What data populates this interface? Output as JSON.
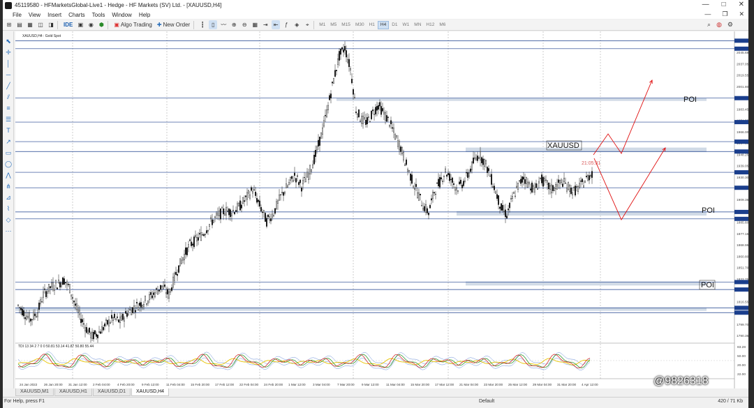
{
  "window": {
    "title": "45119580 - HFMarketsGlobal-Live1 - Hedge - HF Markets (SV) Ltd. - [XAUUSD,H4]",
    "controls": [
      "—",
      "□",
      "✕"
    ]
  },
  "menu": {
    "items": [
      "File",
      "View",
      "Insert",
      "Charts",
      "Tools",
      "Window",
      "Help"
    ],
    "mdi_controls": [
      "—",
      "❐",
      "✕"
    ]
  },
  "toolbar": {
    "algo_trading": "Algo Trading",
    "new_order": "New Order",
    "ide_label": "IDE",
    "timeframes": [
      "M1",
      "M5",
      "M15",
      "M30",
      "H1",
      "H4",
      "D1",
      "W1",
      "MN",
      "H12",
      "M6"
    ],
    "active_timeframe": "H4"
  },
  "chart": {
    "header": "XAUUSD,H4 : Gold Spot",
    "countdown": "21:05:31",
    "price_ticks": [
      "2063.40",
      "2045.68",
      "2037.05",
      "2019.55",
      "2001.80",
      "1992.90",
      "1983.45",
      "1974.55",
      "1966.00",
      "1957.50",
      "1948.25",
      "1939.05",
      "1930.30",
      "1921.65",
      "1909.35",
      "1903.50",
      "1885.60",
      "1877.15",
      "1868.95",
      "1860.80",
      "1851.70",
      "1833.75",
      "1824.75",
      "1816.55",
      "1807.95",
      "1799.70",
      "1790.35"
    ],
    "ind_ticks": [
      "83.28",
      "50.00",
      "20.00",
      "22.00"
    ],
    "time_ticks": [
      "24 Jan 2022",
      "26 Jan 20:00",
      "31 Jan 12:00",
      "2 Feb 04:00",
      "4 Feb 20:00",
      "9 Feb 12:00",
      "11 Feb 04:00",
      "15 Feb 20:00",
      "17 Feb 12:00",
      "22 Feb 04:00",
      "24 Feb 20:00",
      "1 Mar 12:00",
      "3 Mar 04:00",
      "7 Mar 20:00",
      "9 Mar 12:00",
      "11 Mar 04:00",
      "15 Mar 20:00",
      "17 Mar 12:00",
      "21 Mar 04:00",
      "23 Mar 20:00",
      "25 Mar 12:00",
      "29 Mar 04:00",
      "31 Mar 20:00",
      "4 Apr 12:00"
    ],
    "indicator_label": "TDI 13 34 2 7 0 0 50.81 53.14 41.87 50.80 55.44",
    "annotations": {
      "poi_top": "POI",
      "poi_mid": "POI",
      "poi_bottom": "POI",
      "symbol_box": "XAUUSD"
    }
  },
  "chart_data": {
    "type": "candlestick",
    "symbol": "XAUUSD",
    "timeframe": "H4",
    "title": "XAUUSD,H4 : Gold Spot",
    "x_range": [
      "24 Jan 2022",
      "4 Apr 2022"
    ],
    "y_range": [
      1784,
      2070
    ],
    "horizontal_levels": [
      2066.5,
      2059.0,
      2012.6,
      1990.1,
      1971.8,
      1962.5,
      1943.0,
      1928.5,
      1905.8,
      1899.3,
      1840.0,
      1833.0,
      1815.8,
      1811.3
    ],
    "path_points": [
      [
        0,
        1818
      ],
      [
        5,
        1810
      ],
      [
        9,
        1805
      ],
      [
        14,
        1812
      ],
      [
        18,
        1828
      ],
      [
        23,
        1835
      ],
      [
        28,
        1838
      ],
      [
        33,
        1842
      ],
      [
        37,
        1834
      ],
      [
        41,
        1818
      ],
      [
        45,
        1806
      ],
      [
        49,
        1796
      ],
      [
        53,
        1789
      ],
      [
        58,
        1793
      ],
      [
        63,
        1800
      ],
      [
        68,
        1806
      ],
      [
        73,
        1803
      ],
      [
        78,
        1811
      ],
      [
        83,
        1816
      ],
      [
        88,
        1820
      ],
      [
        93,
        1824
      ],
      [
        98,
        1830
      ],
      [
        103,
        1836
      ],
      [
        108,
        1828
      ],
      [
        113,
        1848
      ],
      [
        118,
        1863
      ],
      [
        123,
        1875
      ],
      [
        128,
        1880
      ],
      [
        133,
        1886
      ],
      [
        138,
        1896
      ],
      [
        143,
        1902
      ],
      [
        148,
        1907
      ],
      [
        153,
        1906
      ],
      [
        158,
        1910
      ],
      [
        163,
        1918
      ],
      [
        168,
        1927
      ],
      [
        173,
        1912
      ],
      [
        178,
        1897
      ],
      [
        183,
        1905
      ],
      [
        188,
        1920
      ],
      [
        193,
        1930
      ],
      [
        198,
        1940
      ],
      [
        203,
        1930
      ],
      [
        208,
        1941
      ],
      [
        213,
        1959
      ],
      [
        218,
        1982
      ],
      [
        222,
        2005
      ],
      [
        226,
        2030
      ],
      [
        230,
        2052
      ],
      [
        234,
        2060
      ],
      [
        238,
        2040
      ],
      [
        242,
        2002
      ],
      [
        246,
        1992
      ],
      [
        250,
        1990
      ],
      [
        254,
        1999
      ],
      [
        258,
        2006
      ],
      [
        262,
        1998
      ],
      [
        266,
        1990
      ],
      [
        270,
        1977
      ],
      [
        274,
        1966
      ],
      [
        278,
        1950
      ],
      [
        282,
        1936
      ],
      [
        286,
        1924
      ],
      [
        290,
        1912
      ],
      [
        294,
        1905
      ],
      [
        298,
        1925
      ],
      [
        302,
        1934
      ],
      [
        306,
        1944
      ],
      [
        310,
        1937
      ],
      [
        314,
        1928
      ],
      [
        318,
        1932
      ],
      [
        322,
        1940
      ],
      [
        326,
        1952
      ],
      [
        330,
        1960
      ],
      [
        334,
        1953
      ],
      [
        338,
        1940
      ],
      [
        342,
        1925
      ],
      [
        346,
        1909
      ],
      [
        350,
        1903
      ],
      [
        354,
        1918
      ],
      [
        358,
        1930
      ],
      [
        362,
        1938
      ],
      [
        366,
        1932
      ],
      [
        370,
        1926
      ],
      [
        374,
        1937
      ],
      [
        378,
        1932
      ],
      [
        382,
        1927
      ],
      [
        386,
        1931
      ],
      [
        390,
        1934
      ],
      [
        394,
        1929
      ],
      [
        398,
        1925
      ],
      [
        402,
        1929
      ],
      [
        406,
        1935
      ],
      [
        410,
        1941
      ],
      [
        414,
        1946
      ]
    ]
  },
  "tabs": {
    "items": [
      "XAUUSD,M1",
      "XAUUSD,H1",
      "XAUUSD,D1",
      "XAUUSD,H4"
    ],
    "active": 3
  },
  "status": {
    "help": "For Help, press F1",
    "profile": "Default",
    "traffic": "420 / 71 Kb"
  },
  "watermark": "@9826318"
}
